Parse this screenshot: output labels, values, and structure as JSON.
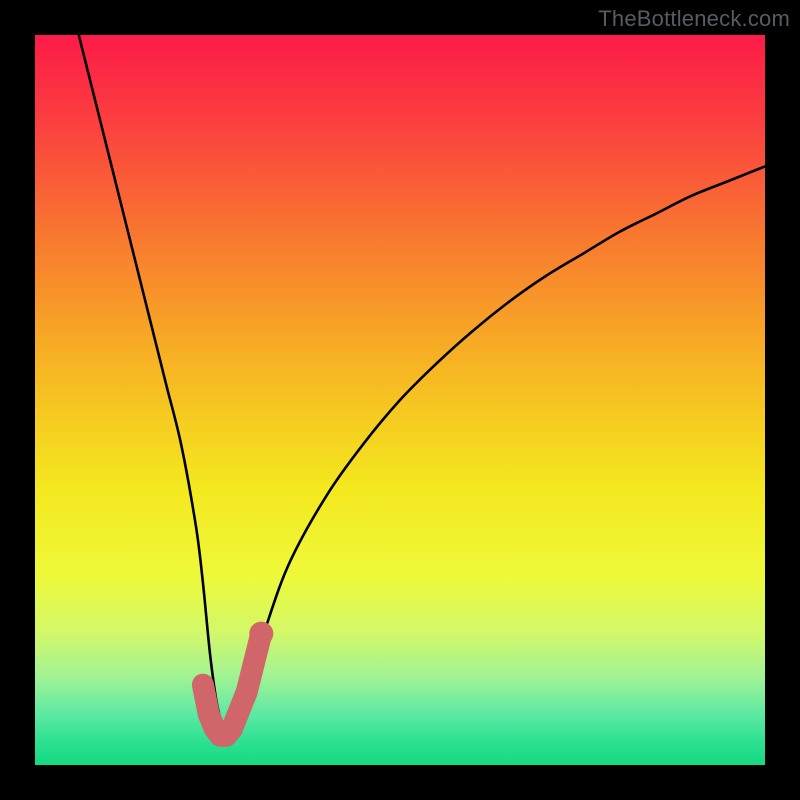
{
  "watermark": "TheBottleneck.com",
  "chart_data": {
    "type": "line",
    "title": "",
    "xlabel": "",
    "ylabel": "",
    "xlim": [
      0,
      100
    ],
    "ylim": [
      0,
      100
    ],
    "grid": false,
    "legend": false,
    "series": [
      {
        "name": "curve",
        "color": "#000000",
        "x": [
          6,
          8,
          10,
          12,
          14,
          16,
          18,
          20,
          22,
          23,
          24,
          25,
          26,
          27,
          28,
          29,
          30,
          32,
          35,
          40,
          45,
          50,
          55,
          60,
          65,
          70,
          75,
          80,
          85,
          90,
          95,
          100
        ],
        "y": [
          100,
          92,
          84,
          76,
          68,
          60,
          52,
          44,
          33,
          25,
          15,
          8,
          5,
          4,
          5,
          8,
          13,
          20,
          28,
          37,
          44,
          50,
          55,
          59.5,
          63.5,
          67,
          70,
          73,
          75.5,
          78,
          80,
          82
        ]
      },
      {
        "name": "highlight",
        "color": "#d0656a",
        "x": [
          23,
          23.8,
          24.6,
          25.4,
          26.2,
          27,
          27.8,
          29,
          30,
          31
        ],
        "y": [
          11,
          7,
          5,
          4,
          4,
          5,
          7,
          10,
          14,
          18
        ]
      }
    ],
    "gradient_stops": [
      {
        "offset": 0.0,
        "color": "#fc1b48"
      },
      {
        "offset": 0.12,
        "color": "#fb3f3f"
      },
      {
        "offset": 0.28,
        "color": "#f87a2f"
      },
      {
        "offset": 0.45,
        "color": "#f7b423"
      },
      {
        "offset": 0.62,
        "color": "#f4e81e"
      },
      {
        "offset": 0.74,
        "color": "#eef93a"
      },
      {
        "offset": 0.82,
        "color": "#d2f86a"
      },
      {
        "offset": 0.88,
        "color": "#a0f394"
      },
      {
        "offset": 0.93,
        "color": "#5de9a3"
      },
      {
        "offset": 0.97,
        "color": "#2be091"
      },
      {
        "offset": 1.0,
        "color": "#15d97f"
      }
    ]
  }
}
